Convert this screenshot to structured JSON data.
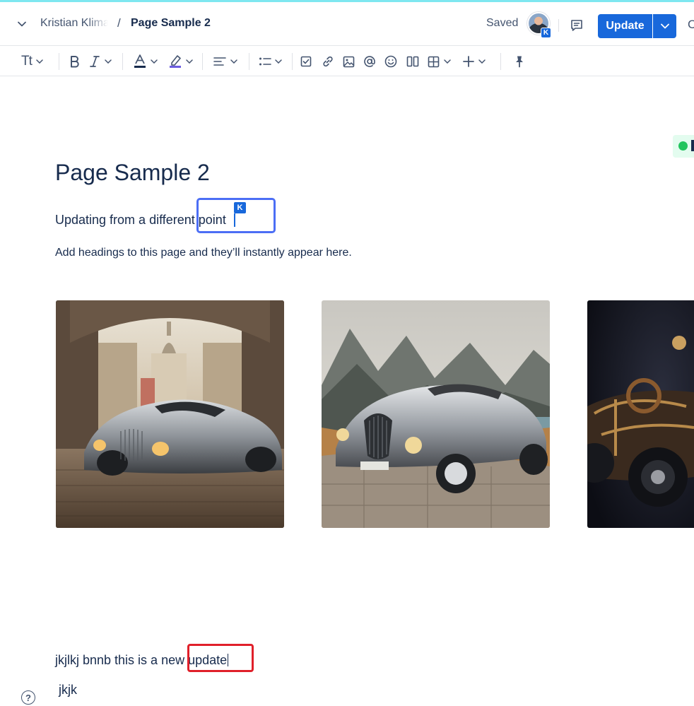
{
  "header": {
    "breadcrumb_parent": "Kristian Klima",
    "breadcrumb_separator": "/",
    "breadcrumb_current": "Page Sample 2",
    "save_status": "Saved",
    "avatar_initial": "K",
    "update_label": "Update",
    "close_partial": "C"
  },
  "toolbar": {
    "text_style_label": "Tt",
    "items": [
      "text-style",
      "bold",
      "italic",
      "text-color",
      "highlight",
      "align",
      "bullet-list",
      "task-list",
      "link",
      "image",
      "mention",
      "emoji",
      "layouts",
      "table",
      "insert-more",
      "pin"
    ]
  },
  "content": {
    "title": "Page Sample 2",
    "para1_text": "Updating from a different ",
    "para1_highlight": "point",
    "collaborator_initial": "K",
    "para2": "Add headings to this page and they’ll instantly appear here.",
    "para3_text": "jkjlkj bnnb this is a new ",
    "para3_highlight": "update",
    "para4": "jkjk"
  },
  "help_label": "?",
  "colors": {
    "accent": "#1868db",
    "collab_outline": "#4c6ef5",
    "red_outline": "#e0202a",
    "top_bar": "#7ee7f0",
    "status_dot": "#22c55e"
  }
}
